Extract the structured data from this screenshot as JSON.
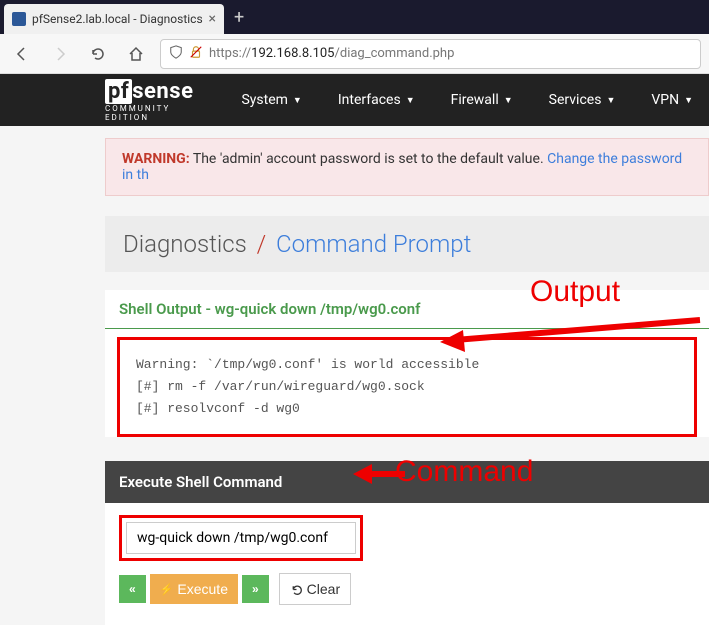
{
  "browser": {
    "tab_title": "pfSense2.lab.local - Diagnostics",
    "url_prefix": "https://",
    "url_host": "192.168.8.105",
    "url_path": "/diag_command.php"
  },
  "logo": {
    "brand": "sense",
    "prefix": "pf",
    "edition": "COMMUNITY EDITION"
  },
  "nav": {
    "items": [
      "System",
      "Interfaces",
      "Firewall",
      "Services",
      "VPN"
    ]
  },
  "warning": {
    "label": "WARNING:",
    "text": " The 'admin' account password is set to the default value. ",
    "link": "Change the password in th"
  },
  "breadcrumb": {
    "section": "Diagnostics",
    "page": "Command Prompt"
  },
  "shell_output": {
    "header": "Shell Output - wg-quick down /tmp/wg0.conf",
    "lines": "Warning: `/tmp/wg0.conf' is world accessible\n[#] rm -f /var/run/wireguard/wg0.sock\n[#] resolvconf -d wg0"
  },
  "execute": {
    "header": "Execute Shell Command",
    "value": "wg-quick down /tmp/wg0.conf",
    "btn_execute": "Execute",
    "btn_clear": "Clear"
  },
  "annotations": {
    "output": "Output",
    "command": "Command"
  }
}
